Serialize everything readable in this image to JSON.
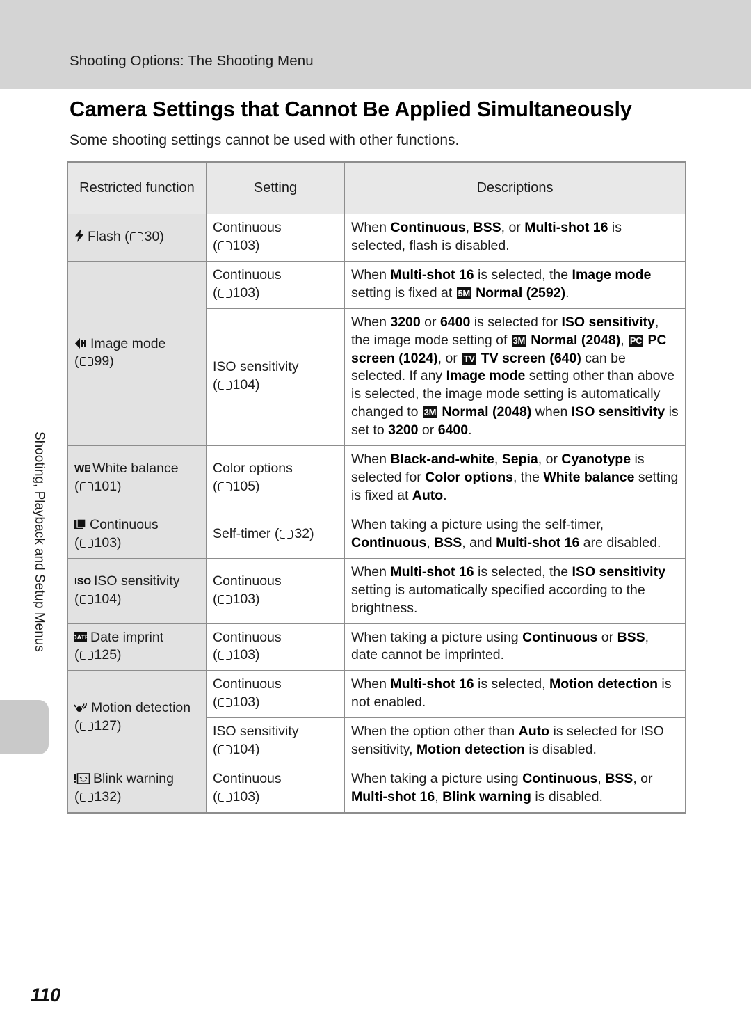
{
  "header": {
    "running_head": "Shooting Options: The Shooting Menu",
    "band_color": "#d4d4d4"
  },
  "side_tab": {
    "label": "Shooting, Playback and Setup Menus"
  },
  "page": {
    "title": "Camera Settings that Cannot Be Applied Simultaneously",
    "intro": "Some shooting settings cannot be used with other functions.",
    "folio": "110"
  },
  "table": {
    "columns": [
      "Restricted function",
      "Setting",
      "Descriptions"
    ],
    "header_bg": "#e8e8e8",
    "function_cell_bg": "#e2e2e2",
    "rows": [
      {
        "function": {
          "icon": "flash-icon",
          "name": "Flash",
          "ref_page": "30"
        },
        "setting": {
          "name": "Continuous",
          "ref_page": "103"
        },
        "description_text": "When Continuous, BSS, or Multi-shot 16 is selected, flash is disabled."
      },
      {
        "function": {
          "icon": "image-mode-icon",
          "name": "Image mode",
          "ref_page": "99"
        },
        "setting": {
          "name": "Continuous",
          "ref_page": "103"
        },
        "description_text": "When Multi-shot 16 is selected, the Image mode setting is fixed at 5M Normal (2592)."
      },
      {
        "function": null,
        "setting": {
          "name": "ISO sensitivity",
          "ref_page": "104"
        },
        "description_text": "When 3200 or 6400 is selected for ISO sensitivity, the image mode setting of 3M Normal (2048), PC PC screen (1024), or TV TV screen (640) can be selected. If any Image mode setting other than above is selected, the image mode setting is automatically changed to 3M Normal (2048) when ISO sensitivity is set to 3200 or 6400."
      },
      {
        "function": {
          "icon": "white-balance-icon",
          "name": "White balance",
          "ref_page": "101"
        },
        "setting": {
          "name": "Color options",
          "ref_page": "105"
        },
        "description_text": "When Black-and-white, Sepia, or Cyanotype is selected for Color options, the White balance setting is fixed at Auto."
      },
      {
        "function": {
          "icon": "continuous-icon",
          "name": "Continuous",
          "ref_page": "103"
        },
        "setting": {
          "name": "Self-timer",
          "ref_page": "32"
        },
        "description_text": "When taking a picture using the self-timer, Continuous, BSS, and Multi-shot 16 are disabled."
      },
      {
        "function": {
          "icon": "iso-icon",
          "name": "ISO sensitivity",
          "ref_page": "104"
        },
        "setting": {
          "name": "Continuous",
          "ref_page": "103"
        },
        "description_text": "When Multi-shot 16 is selected, the ISO sensitivity setting is automatically specified according to the brightness."
      },
      {
        "function": {
          "icon": "date-imprint-icon",
          "name": "Date imprint",
          "ref_page": "125"
        },
        "setting": {
          "name": "Continuous",
          "ref_page": "103"
        },
        "description_text": "When taking a picture using Continuous or BSS, date cannot be imprinted."
      },
      {
        "function": {
          "icon": "motion-detection-icon",
          "name": "Motion detection",
          "ref_page": "127"
        },
        "setting": {
          "name": "Continuous",
          "ref_page": "103"
        },
        "description_text": "When Multi-shot 16 is selected, Motion detection is not enabled."
      },
      {
        "function": null,
        "setting": {
          "name": "ISO sensitivity",
          "ref_page": "104"
        },
        "description_text": "When the option other than Auto is selected for ISO sensitivity, Motion detection is disabled."
      },
      {
        "function": {
          "icon": "blink-warning-icon",
          "name": "Blink warning",
          "ref_page": "132"
        },
        "setting": {
          "name": "Continuous",
          "ref_page": "103"
        },
        "description_text": "When taking a picture using Continuous, BSS, or Multi-shot 16, Blink warning is disabled."
      }
    ],
    "inline_badges": [
      "5M",
      "3M",
      "PC",
      "TV"
    ]
  }
}
